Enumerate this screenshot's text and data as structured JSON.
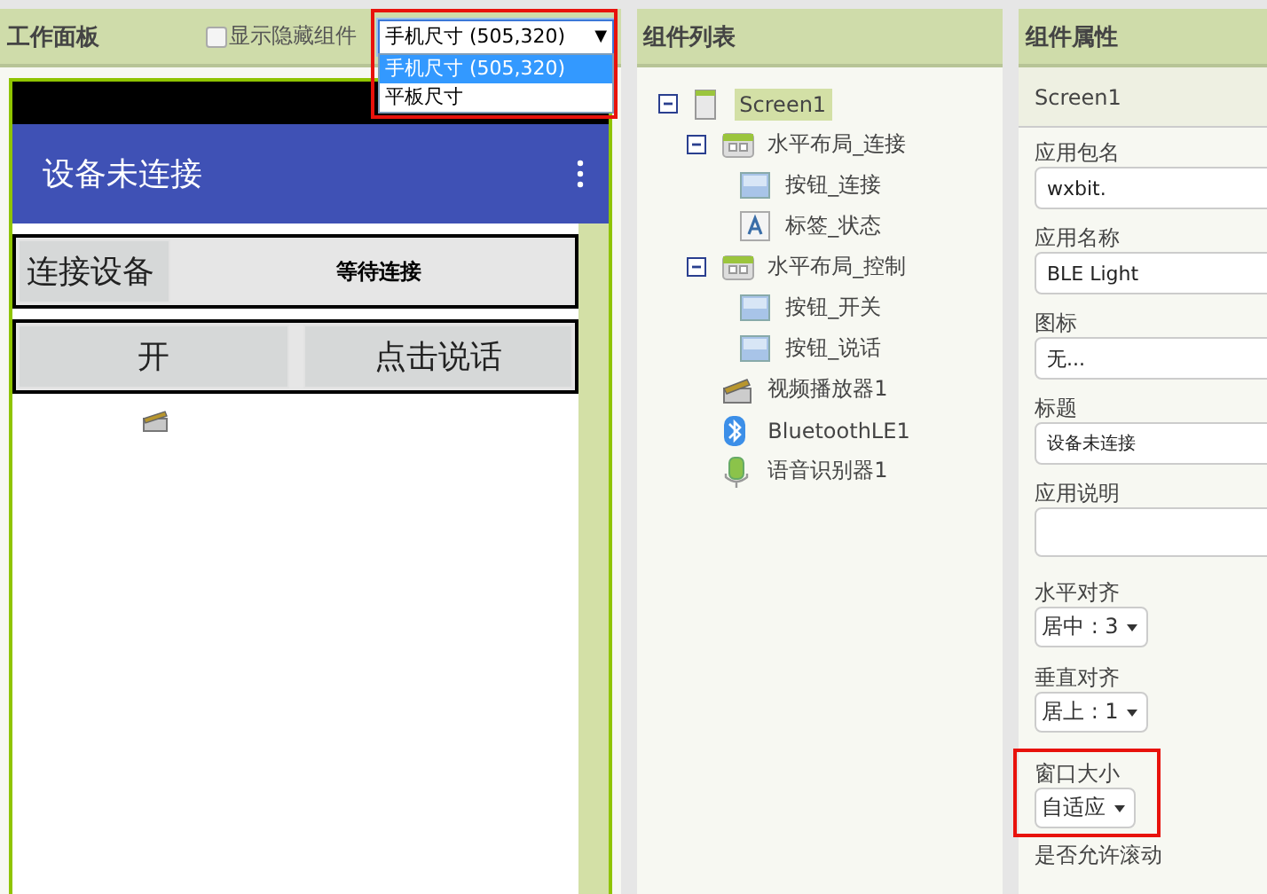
{
  "viewer": {
    "title": "工作面板",
    "show_hidden": {
      "label": "显示隐藏组件",
      "checked": false
    },
    "size_dropdown": {
      "value": "手机尺寸 (505,320)",
      "arrow": "▼",
      "expanded": true,
      "highlighted": true,
      "options": [
        {
          "label": "手机尺寸 (505,320)",
          "selected": true
        },
        {
          "label": "平板尺寸",
          "selected": false
        }
      ]
    },
    "phone": {
      "title": "设备未连接",
      "rows": [
        {
          "items": [
            {
              "kind": "button",
              "text": "连接设备"
            },
            {
              "kind": "label",
              "text": "等待连接"
            }
          ]
        },
        {
          "items": [
            {
              "kind": "button",
              "text": "开"
            },
            {
              "kind": "button",
              "text": "点击说话"
            }
          ]
        }
      ]
    }
  },
  "components": {
    "title": "组件列表",
    "tree": [
      {
        "label": "Screen1",
        "kind": "screen",
        "selected": true,
        "expanded": true,
        "children": [
          {
            "label": "水平布局_连接",
            "kind": "arrangement",
            "selected": false,
            "expanded": true,
            "children": [
              {
                "label": "按钮_连接",
                "kind": "button",
                "selected": false
              },
              {
                "label": "标签_状态",
                "kind": "label",
                "selected": false
              }
            ]
          },
          {
            "label": "水平布局_控制",
            "kind": "arrangement",
            "selected": false,
            "expanded": true,
            "children": [
              {
                "label": "按钮_开关",
                "kind": "button",
                "selected": false
              },
              {
                "label": "按钮_说话",
                "kind": "button",
                "selected": false
              }
            ]
          },
          {
            "label": "视频播放器1",
            "kind": "video",
            "selected": false
          },
          {
            "label": "BluetoothLE1",
            "kind": "bluetooth",
            "selected": false
          },
          {
            "label": "语音识别器1",
            "kind": "speech",
            "selected": false
          }
        ]
      }
    ]
  },
  "properties": {
    "title": "组件属性",
    "component": "Screen1",
    "items": [
      {
        "label": "应用包名",
        "kind": "text",
        "value": "wxbit.",
        "highlighted": false
      },
      {
        "label": "应用名称",
        "kind": "text",
        "value": "BLE Light",
        "highlighted": false
      },
      {
        "label": "图标",
        "kind": "text",
        "value": "无...",
        "highlighted": false
      },
      {
        "label": "标题",
        "kind": "text",
        "value": "设备未连接",
        "highlighted": false
      },
      {
        "label": "应用说明",
        "kind": "textarea",
        "highlighted": false
      },
      {
        "label": "水平对齐",
        "kind": "dropdown",
        "value": "居中 : 3",
        "highlighted": false
      },
      {
        "label": "垂直对齐",
        "kind": "dropdown",
        "value": "居上 : 1",
        "highlighted": false
      },
      {
        "label": "窗口大小",
        "kind": "dropdown",
        "value": "自适应",
        "highlighted": true
      },
      {
        "label": "是否允许滚动",
        "kind": "heading",
        "highlighted": false
      }
    ]
  }
}
